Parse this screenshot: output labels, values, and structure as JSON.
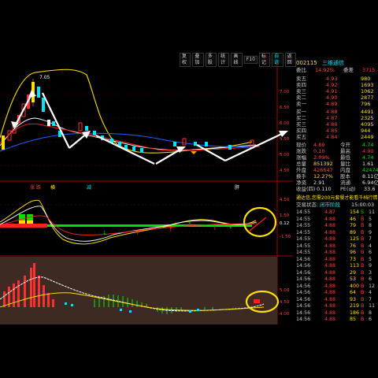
{
  "toolbar": {
    "buttons": [
      "复权",
      "叠加",
      "多股",
      "统计",
      "画线",
      "F10",
      "标记",
      "自选",
      "返回"
    ],
    "selected": "自选"
  },
  "stock": {
    "code": "002115",
    "name": "三维通信"
  },
  "quote": {
    "wei_bi_label": "委比",
    "wei_bi": "14.92%",
    "wei_cha_label": "委差",
    "wei_cha": "3715",
    "asks": [
      {
        "label": "卖五",
        "price": "4.93",
        "vol": "980"
      },
      {
        "label": "卖四",
        "price": "4.92",
        "vol": "1693"
      },
      {
        "label": "卖三",
        "price": "4.91",
        "vol": "1062"
      },
      {
        "label": "卖二",
        "price": "4.90",
        "vol": "2877"
      },
      {
        "label": "卖一",
        "price": "4.89",
        "vol": "796"
      }
    ],
    "bids": [
      {
        "label": "买一",
        "price": "4.88",
        "vol": "4491"
      },
      {
        "label": "买二",
        "price": "4.87",
        "vol": "2325"
      },
      {
        "label": "买三",
        "price": "4.86",
        "vol": "4095"
      },
      {
        "label": "买四",
        "price": "4.85",
        "vol": "944"
      },
      {
        "label": "买五",
        "price": "4.84",
        "vol": "2449"
      }
    ],
    "stats": [
      {
        "l1": "现价",
        "v1": "4.89",
        "l2": "今开",
        "v2": "4.74"
      },
      {
        "l1": "涨跌",
        "v1": "0.10",
        "l2": "最高",
        "v2": "4.90"
      },
      {
        "l1": "涨幅",
        "v1": "2.09%",
        "l2": "最低",
        "v2": "4.74"
      },
      {
        "l1": "总量",
        "v1": "851392",
        "l2": "量比",
        "v2": "1.61"
      },
      {
        "l1": "外盘",
        "v1": "426647",
        "l2": "内盘",
        "v2": "424745"
      },
      {
        "l1": "换手",
        "v1": "12.27%",
        "l2": "股本",
        "v2": "8.11亿"
      },
      {
        "l1": "净资",
        "v1": "2.91",
        "l2": "流通",
        "v2": "6.94亿"
      },
      {
        "l1": "收益(四)",
        "v1": "0.110",
        "l2": "PE(动)",
        "v2": "33.6"
      }
    ],
    "notice1": "通达信,您需200元套餐才能看千档行情",
    "notice2_label": "交易状态:",
    "notice2_value": "闭市阶段",
    "notice2_time": "15:00:03"
  },
  "ticks": [
    {
      "t": "14:55",
      "p": "4.87",
      "v": "154",
      "d": "S",
      "n": "11"
    },
    {
      "t": "14:55",
      "p": "4.88",
      "v": "46",
      "d": "B",
      "n": "5"
    },
    {
      "t": "14:55",
      "p": "4.88",
      "v": "79",
      "d": "B",
      "n": "8"
    },
    {
      "t": "14:55",
      "p": "4.88",
      "v": "89",
      "d": "B",
      "n": "9"
    },
    {
      "t": "14:55",
      "p": "4.88",
      "v": "125",
      "d": "B",
      "n": "7"
    },
    {
      "t": "14:55",
      "p": "4.88",
      "v": "76",
      "d": "B",
      "n": "4"
    },
    {
      "t": "14:55",
      "p": "4.88",
      "v": "96",
      "d": "B",
      "n": "6"
    },
    {
      "t": "14:56",
      "p": "4.88",
      "v": "73",
      "d": "B",
      "n": "5"
    },
    {
      "t": "14:56",
      "p": "4.88",
      "v": "113",
      "d": "B",
      "n": "9"
    },
    {
      "t": "14:56",
      "p": "4.88",
      "v": "29",
      "d": "B",
      "n": "3"
    },
    {
      "t": "14:56",
      "p": "4.88",
      "v": "53",
      "d": "B",
      "n": "6"
    },
    {
      "t": "14:56",
      "p": "4.88",
      "v": "400",
      "d": "B",
      "n": "12"
    },
    {
      "t": "14:56",
      "p": "4.88",
      "v": "64",
      "d": "B",
      "n": "4"
    },
    {
      "t": "14:56",
      "p": "4.88",
      "v": "93",
      "d": "B",
      "n": "7"
    },
    {
      "t": "14:56",
      "p": "4.88",
      "v": "219",
      "d": "B",
      "n": "11"
    },
    {
      "t": "14:56",
      "p": "4.88",
      "v": "186",
      "d": "B",
      "n": "8"
    },
    {
      "t": "14:56",
      "p": "4.88",
      "v": "85",
      "d": "B",
      "n": "6"
    }
  ],
  "main_chart": {
    "high_marker": "7.05",
    "y_ticks": [
      "7.00",
      "6.50",
      "6.00",
      "5.50",
      "5.00",
      "4.50"
    ],
    "marks": [
      "涨",
      "跌",
      "横",
      "减",
      "肝"
    ]
  },
  "sub_chart": {
    "value_label": "0.12",
    "y_ticks": [
      "4.50",
      "1.50",
      "-1.50"
    ]
  },
  "macd_chart": {
    "y_ticks": [
      "5.00",
      "4.50",
      "4.00"
    ]
  },
  "colors": {
    "up": "#ff3030",
    "down": "#00e5ff",
    "ma_yellow": "#ffe000",
    "arrow": "#ffffff"
  }
}
